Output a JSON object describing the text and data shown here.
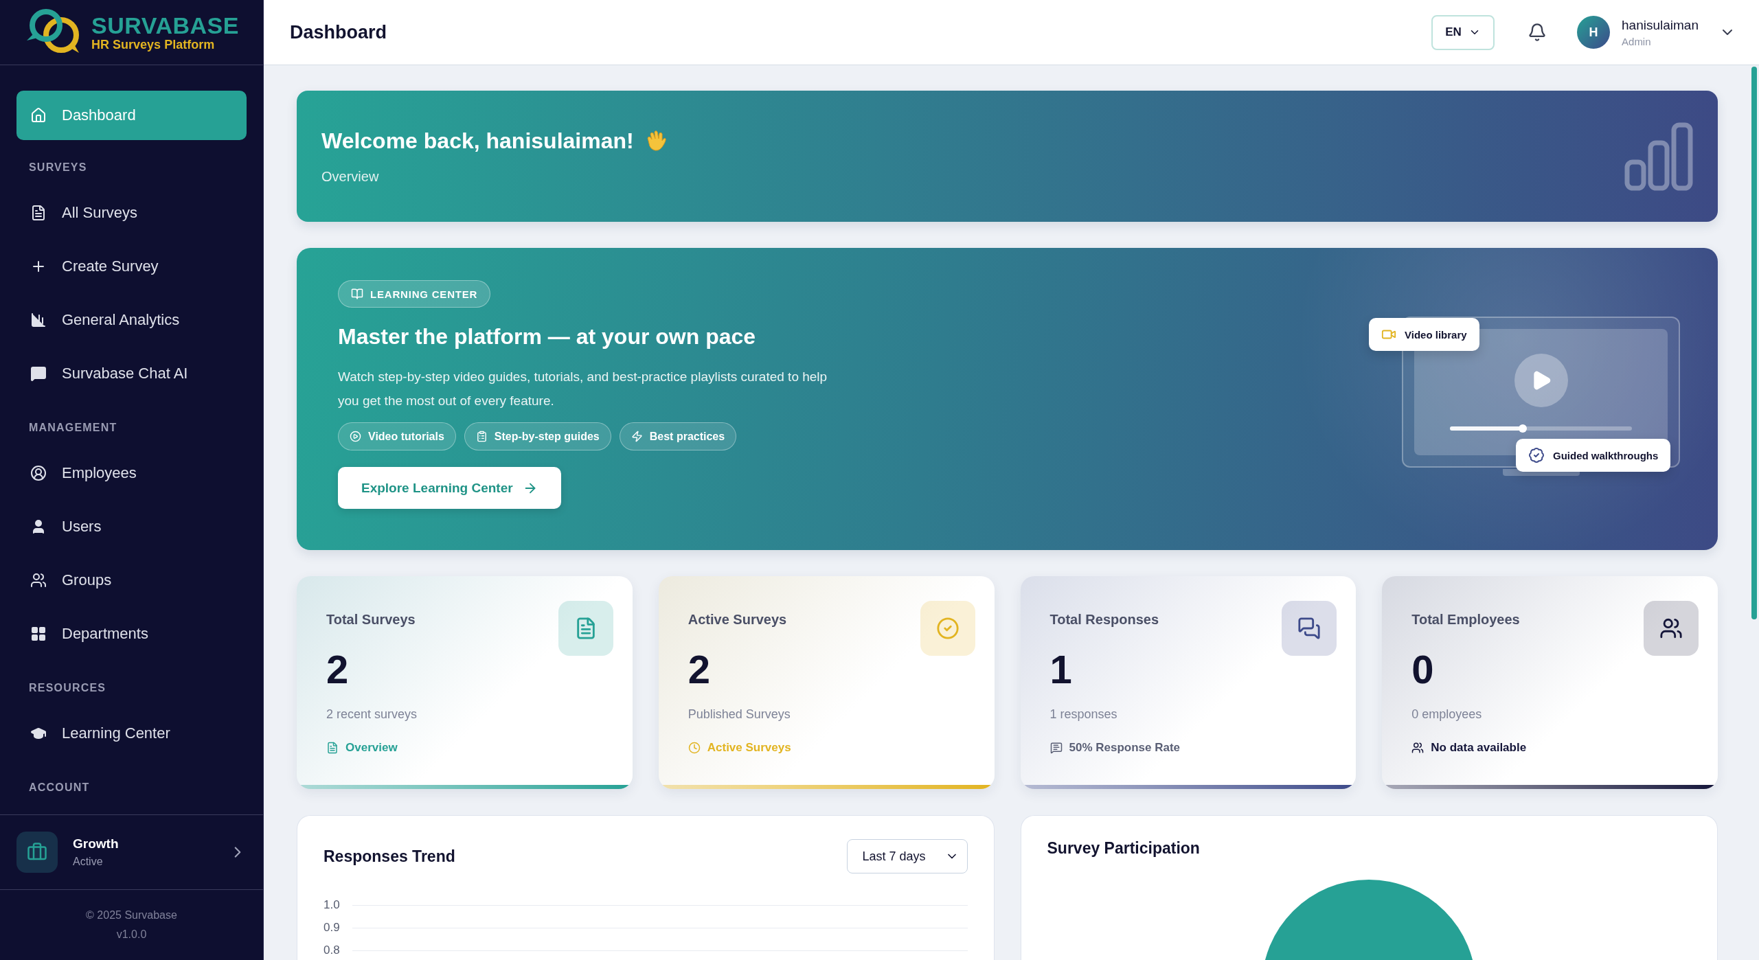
{
  "sidebar": {
    "logo": {
      "name": "SURVABASE",
      "tagline": "HR Surveys Platform"
    },
    "sections": [
      {
        "items": [
          {
            "label": "Dashboard",
            "selected": true
          }
        ]
      },
      {
        "heading": "SURVEYS",
        "items": [
          {
            "label": "All Surveys",
            "selected": false
          },
          {
            "label": "Create Survey",
            "selected": false
          },
          {
            "label": "General Analytics",
            "selected": false
          },
          {
            "label": "Survabase Chat AI",
            "selected": false
          }
        ]
      },
      {
        "heading": "MANAGEMENT",
        "items": [
          {
            "label": "Employees",
            "selected": false
          },
          {
            "label": "Users",
            "selected": false
          },
          {
            "label": "Groups",
            "selected": false
          },
          {
            "label": "Departments",
            "selected": false
          }
        ]
      },
      {
        "heading": "RESOURCES",
        "items": [
          {
            "label": "Learning Center",
            "selected": false
          }
        ]
      },
      {
        "heading": "ACCOUNT"
      }
    ],
    "plan": {
      "name": "Growth",
      "status": "Active"
    },
    "footer": [
      "© 2025 Survabase",
      "v1.0.0"
    ]
  },
  "header": {
    "title": "Dashboard",
    "language": "EN",
    "user": {
      "initial": "H",
      "name": "hanisulaiman",
      "role": "Admin"
    }
  },
  "welcome": {
    "title": "Welcome back, hanisulaiman!",
    "subtitle": "Overview"
  },
  "learning": {
    "badge": "LEARNING CENTER",
    "title": "Master the platform — at your own pace",
    "description": "Watch step-by-step video guides, tutorials, and best-practice playlists curated to help you get the most out of every feature.",
    "chips": [
      "Video tutorials",
      "Step-by-step guides",
      "Best practices"
    ],
    "button": "Explore Learning Center",
    "preview": {
      "video_label": "Video library",
      "walkthrough_label": "Guided walkthroughs",
      "level": 0.4
    }
  },
  "stats": [
    {
      "title": "Total Surveys",
      "value": "2",
      "caption": "2 recent surveys",
      "footer": "Overview",
      "color": "#26a195"
    },
    {
      "title": "Active Surveys",
      "value": "2",
      "caption": "Published Surveys",
      "footer": "Active Surveys",
      "color": "#e2b421"
    },
    {
      "title": "Total Responses",
      "value": "1",
      "caption": "1 responses",
      "footer": "50% Response Rate",
      "color": "#3d4a8a"
    },
    {
      "title": "Total Employees",
      "value": "0",
      "caption": "0 employees",
      "footer": "No data available",
      "color": "#15163a"
    }
  ],
  "trend": {
    "title": "Responses Trend",
    "range": "Last 7 days",
    "y_labels": [
      "1.0",
      "0.9",
      "0.8"
    ]
  },
  "participation": {
    "title": "Survey Participation"
  }
}
